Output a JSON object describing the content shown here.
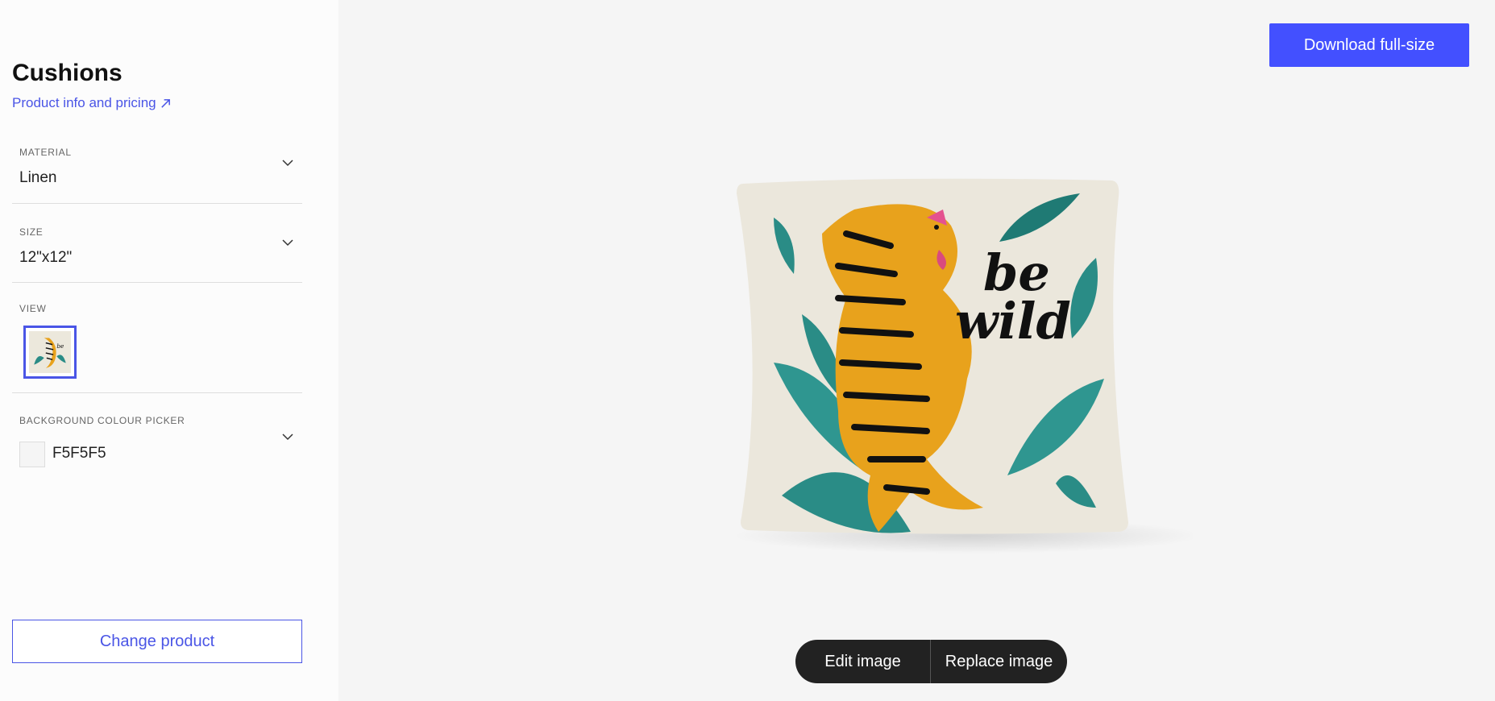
{
  "sidebar": {
    "title": "Cushions",
    "product_link": "Product info and pricing",
    "material": {
      "label": "MATERIAL",
      "value": "Linen"
    },
    "size": {
      "label": "SIZE",
      "value": "12\"x12\""
    },
    "view": {
      "label": "VIEW"
    },
    "background": {
      "label": "BACKGROUND COLOUR PICKER",
      "value": "F5F5F5",
      "swatch_color": "#F5F5F5"
    },
    "change_product": "Change product"
  },
  "header": {
    "download_label": "Download full-size"
  },
  "preview": {
    "cushion_text_line1": "be",
    "cushion_text_line2": "wild"
  },
  "actions": {
    "edit_label": "Edit image",
    "replace_label": "Replace image"
  },
  "colors": {
    "accent": "#4350FF",
    "link": "#4A55E6",
    "pill_bg": "#222222",
    "tiger": "#E8A21C",
    "leaf": "#2A8C86"
  }
}
